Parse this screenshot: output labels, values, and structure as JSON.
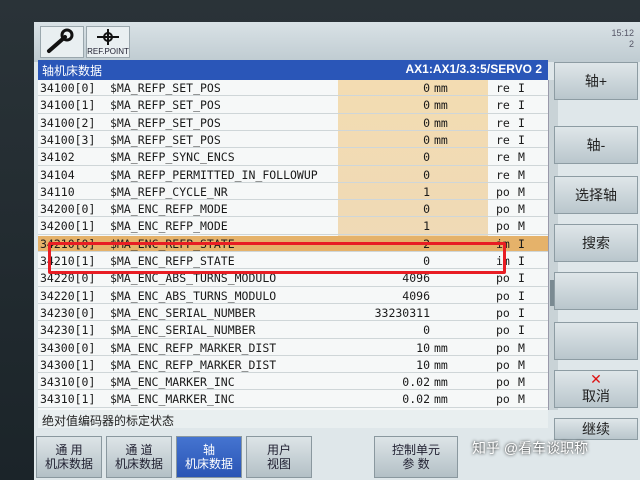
{
  "topbar": {
    "refpoint_label": "REF.POINT",
    "clock": "15:12\n2"
  },
  "title": {
    "left": "轴机床数据",
    "right": "AX1:AX1/3.3:5/SERVO 2"
  },
  "rows": [
    {
      "no": "34100[0]",
      "name": "$MA_REFP_SET_POS",
      "val": "0",
      "unit": "mm",
      "a": "re",
      "b": "I"
    },
    {
      "no": "34100[1]",
      "name": "$MA_REFP_SET_POS",
      "val": "0",
      "unit": "mm",
      "a": "re",
      "b": "I"
    },
    {
      "no": "34100[2]",
      "name": "$MA_REFP_SET_POS",
      "val": "0",
      "unit": "mm",
      "a": "re",
      "b": "I"
    },
    {
      "no": "34100[3]",
      "name": "$MA_REFP_SET_POS",
      "val": "0",
      "unit": "mm",
      "a": "re",
      "b": "I"
    },
    {
      "no": "34102",
      "name": "$MA_REFP_SYNC_ENCS",
      "val": "0",
      "unit": "",
      "a": "re",
      "b": "M"
    },
    {
      "no": "34104",
      "name": "$MA_REFP_PERMITTED_IN_FOLLOWUP",
      "val": "0",
      "unit": "",
      "a": "re",
      "b": "M"
    },
    {
      "no": "34110",
      "name": "$MA_REFP_CYCLE_NR",
      "val": "1",
      "unit": "",
      "a": "po",
      "b": "M"
    },
    {
      "no": "34200[0]",
      "name": "$MA_ENC_REFP_MODE",
      "val": "0",
      "unit": "",
      "a": "po",
      "b": "M"
    },
    {
      "no": "34200[1]",
      "name": "$MA_ENC_REFP_MODE",
      "val": "1",
      "unit": "",
      "a": "po",
      "b": "M"
    },
    {
      "no": "34210[0]",
      "name": "$MA_ENC_REFP_STATE",
      "val": "2",
      "unit": "",
      "a": "im",
      "b": "I"
    },
    {
      "no": "34210[1]",
      "name": "$MA_ENC_REFP_STATE",
      "val": "0",
      "unit": "",
      "a": "im",
      "b": "I"
    },
    {
      "no": "34220[0]",
      "name": "$MA_ENC_ABS_TURNS_MODULO",
      "val": "4096",
      "unit": "",
      "a": "po",
      "b": "I"
    },
    {
      "no": "34220[1]",
      "name": "$MA_ENC_ABS_TURNS_MODULO",
      "val": "4096",
      "unit": "",
      "a": "po",
      "b": "I"
    },
    {
      "no": "34230[0]",
      "name": "$MA_ENC_SERIAL_NUMBER",
      "val": "33230311",
      "unit": "",
      "a": "po",
      "b": "I"
    },
    {
      "no": "34230[1]",
      "name": "$MA_ENC_SERIAL_NUMBER",
      "val": "0",
      "unit": "",
      "a": "po",
      "b": "I"
    },
    {
      "no": "34300[0]",
      "name": "$MA_ENC_REFP_MARKER_DIST",
      "val": "10",
      "unit": "mm",
      "a": "po",
      "b": "M"
    },
    {
      "no": "34300[1]",
      "name": "$MA_ENC_REFP_MARKER_DIST",
      "val": "10",
      "unit": "mm",
      "a": "po",
      "b": "M"
    },
    {
      "no": "34310[0]",
      "name": "$MA_ENC_MARKER_INC",
      "val": "0.02",
      "unit": "mm",
      "a": "po",
      "b": "M"
    },
    {
      "no": "34310[1]",
      "name": "$MA_ENC_MARKER_INC",
      "val": "0.02",
      "unit": "mm",
      "a": "po",
      "b": "M"
    }
  ],
  "description": "绝对值编码器的标定状态",
  "right_keys": {
    "axis_plus": "轴+",
    "axis_minus": "轴-",
    "select_axis": "选择轴",
    "search": "搜索",
    "cancel": "取消",
    "continue": "继续"
  },
  "bottom_keys": {
    "general": "通 用\n机床数据",
    "channel": "通 道\n机床数据",
    "axis": "轴\n机床数据",
    "user_view": "用户\n视图",
    "control_unit": "控制单元\n参 数"
  },
  "watermark": "知乎 @看车谈职称",
  "colors": {
    "title_bg": "#2a56b8",
    "selected_row": "#e5b26a",
    "highlight_box": "#e81d24",
    "active_key": "#2a55b5"
  }
}
